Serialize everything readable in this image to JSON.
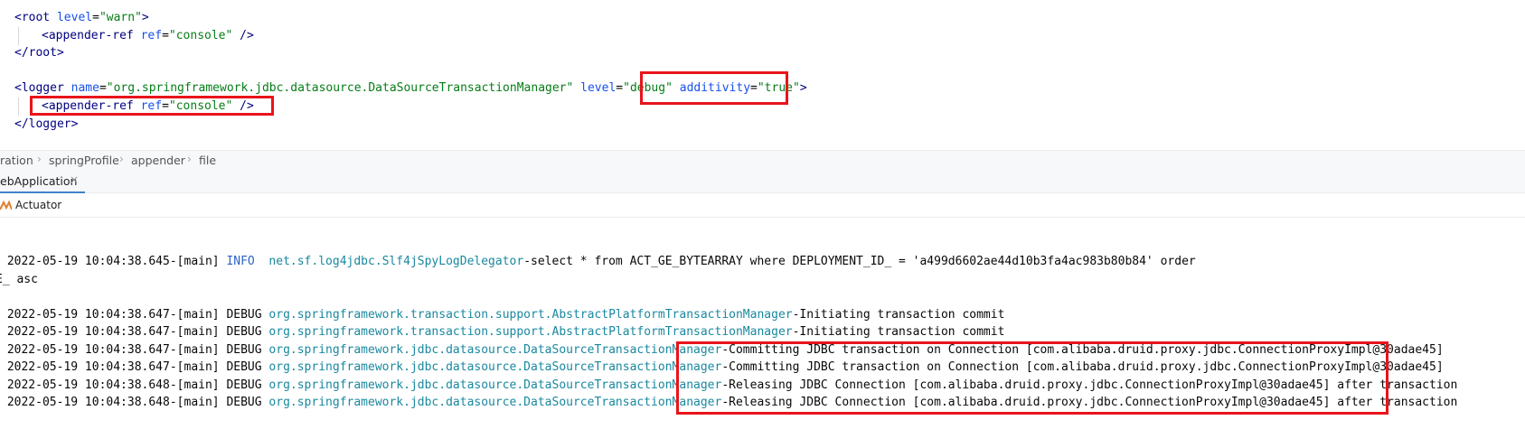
{
  "editor": {
    "root_open": {
      "lt": "<",
      "tag": "root",
      "attr": "level",
      "eq": "=",
      "val": "\"warn\"",
      "gt": ">"
    },
    "root_appender": {
      "lt": "<",
      "tag": "appender-ref",
      "attr": "ref",
      "eq": "=",
      "val": "\"console\"",
      "close": " />"
    },
    "root_close": {
      "text": "</root>"
    },
    "logger_open": {
      "lt": "<",
      "tag": "logger",
      "attr1": "name",
      "eq": "=",
      "val1": "\"org.springframework.jdbc.datasource.DataSourceTransactionManager\"",
      "attr2": "level",
      "val2": "\"debug\"",
      "attr3": "additivity",
      "val3": "\"true\"",
      "gt": ">"
    },
    "logger_appender": {
      "lt": "<",
      "tag": "appender-ref",
      "attr": "ref",
      "eq": "=",
      "val": "\"console\"",
      "close": " />"
    },
    "logger_close": {
      "text": "</logger>"
    }
  },
  "breadcrumb": [
    "ration",
    "springProfile",
    "appender",
    "file"
  ],
  "run_tab": {
    "label": "ebApplication",
    "close": "×"
  },
  "toolbar": {
    "actuator_label": "Actuator"
  },
  "console": {
    "line1": {
      "prefix": " 2022-05-19 10:04:38.645-[main] ",
      "level": "INFO ",
      "logger": "net.sf.log4jdbc.Slf4jSpyLogDelegator",
      "message": "-select * from ACT_GE_BYTEARRAY where DEPLOYMENT_ID_ = 'a499d6602ae44d10b3fa4ac983b80b84' order"
    },
    "line1_wrap": "E_ asc",
    "lines": [
      {
        "prefix": " 2022-05-19 10:04:38.647-[main] ",
        "level": "DEBUG",
        "logger": "org.springframework.transaction.support.AbstractPlatformTransactionManager",
        "message": "-Initiating transaction commit"
      },
      {
        "prefix": " 2022-05-19 10:04:38.647-[main] ",
        "level": "DEBUG",
        "logger": "org.springframework.transaction.support.AbstractPlatformTransactionManager",
        "message": "-Initiating transaction commit"
      },
      {
        "prefix": " 2022-05-19 10:04:38.647-[main] ",
        "level": "DEBUG",
        "logger": "org.springframework.jdbc.datasource.DataSourceTransactionManager",
        "message": "-Committing JDBC transaction on Connection [com.alibaba.druid.proxy.jdbc.ConnectionProxyImpl@30adae45]"
      },
      {
        "prefix": " 2022-05-19 10:04:38.647-[main] ",
        "level": "DEBUG",
        "logger": "org.springframework.jdbc.datasource.DataSourceTransactionManager",
        "message": "-Committing JDBC transaction on Connection [com.alibaba.druid.proxy.jdbc.ConnectionProxyImpl@30adae45]"
      },
      {
        "prefix": " 2022-05-19 10:04:38.648-[main] ",
        "level": "DEBUG",
        "logger": "org.springframework.jdbc.datasource.DataSourceTransactionManager",
        "message": "-Releasing JDBC Connection [com.alibaba.druid.proxy.jdbc.ConnectionProxyImpl@30adae45] after transaction"
      },
      {
        "prefix": " 2022-05-19 10:04:38.648-[main] ",
        "level": "DEBUG",
        "logger": "org.springframework.jdbc.datasource.DataSourceTransactionManager",
        "message": "-Releasing JDBC Connection [com.alibaba.druid.proxy.jdbc.ConnectionProxyImpl@30adae45] after transaction"
      }
    ]
  },
  "colors": {
    "highlight_box": "#e8141a",
    "xml_tag": "#000080",
    "xml_attr": "#1750eb",
    "xml_value": "#067d17",
    "log_info": "#2f63c8",
    "log_logger": "#19889f"
  }
}
